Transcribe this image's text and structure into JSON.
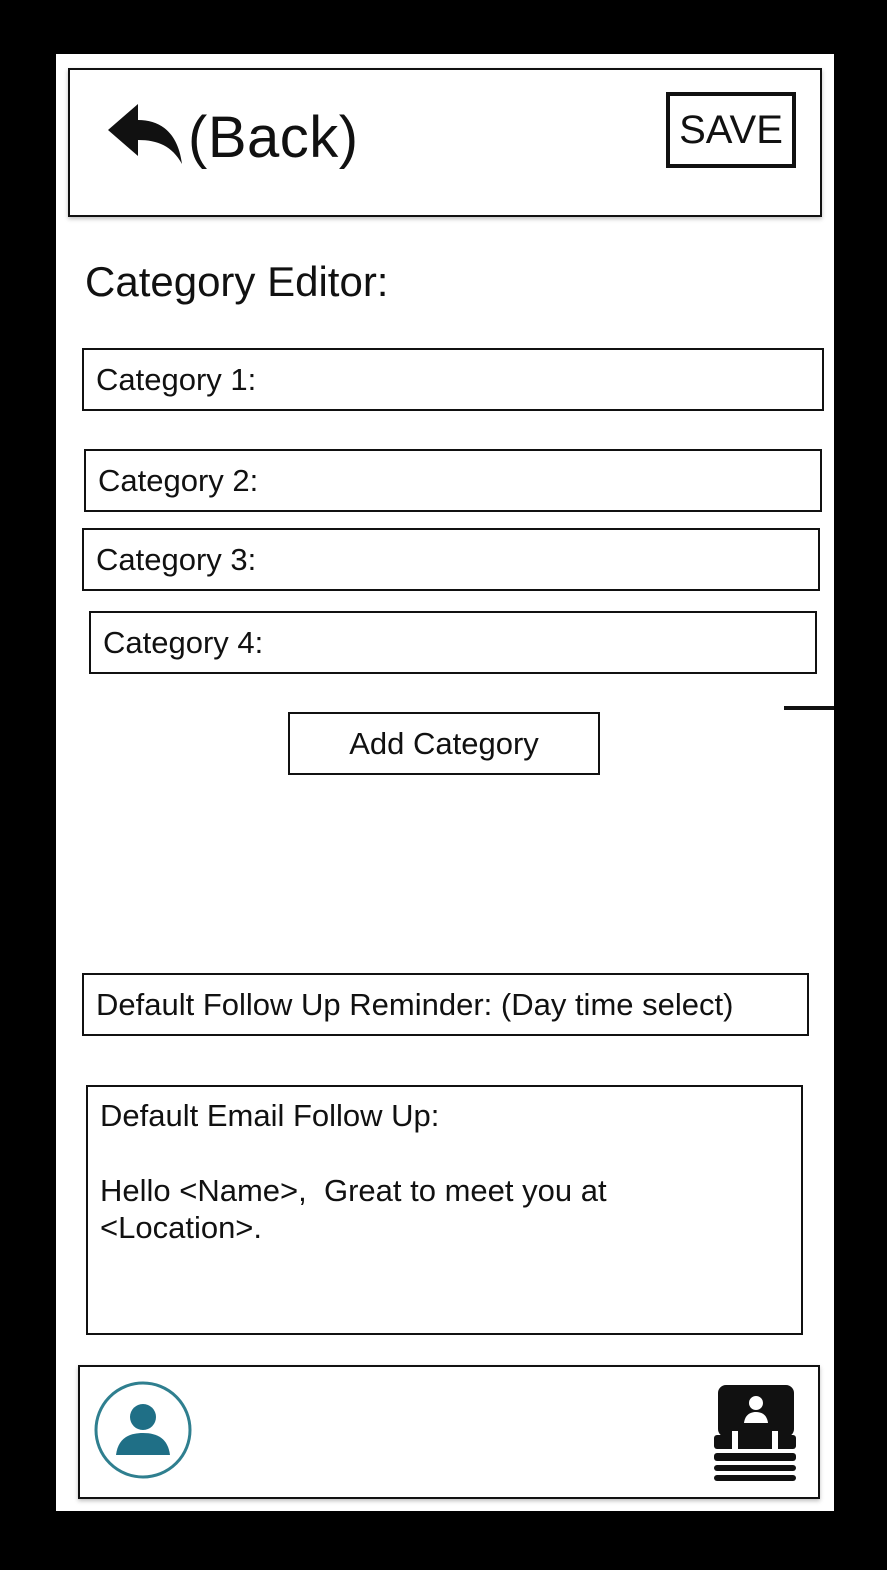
{
  "header": {
    "back_icon": "back-arrow-icon",
    "back_label": "(Back)",
    "save_label": "SAVE"
  },
  "page_title": "Category Editor:",
  "categories": [
    {
      "label": "Category 1:"
    },
    {
      "label": "Category 2:"
    },
    {
      "label": "Category 3:"
    },
    {
      "label": "Category 4:"
    }
  ],
  "add_category_label": "Add Category",
  "follow_up_reminder_label": "Default Follow Up Reminder: (Day time select)",
  "email_follow_up": {
    "label": "Default Email Follow Up:",
    "body": "Hello <Name>,  Great to meet you at\n<Location>."
  },
  "bottom_bar": {
    "profile_icon": "profile-avatar-icon",
    "contacts_icon": "contact-cards-icon",
    "accent_color": "#1f6f86"
  }
}
